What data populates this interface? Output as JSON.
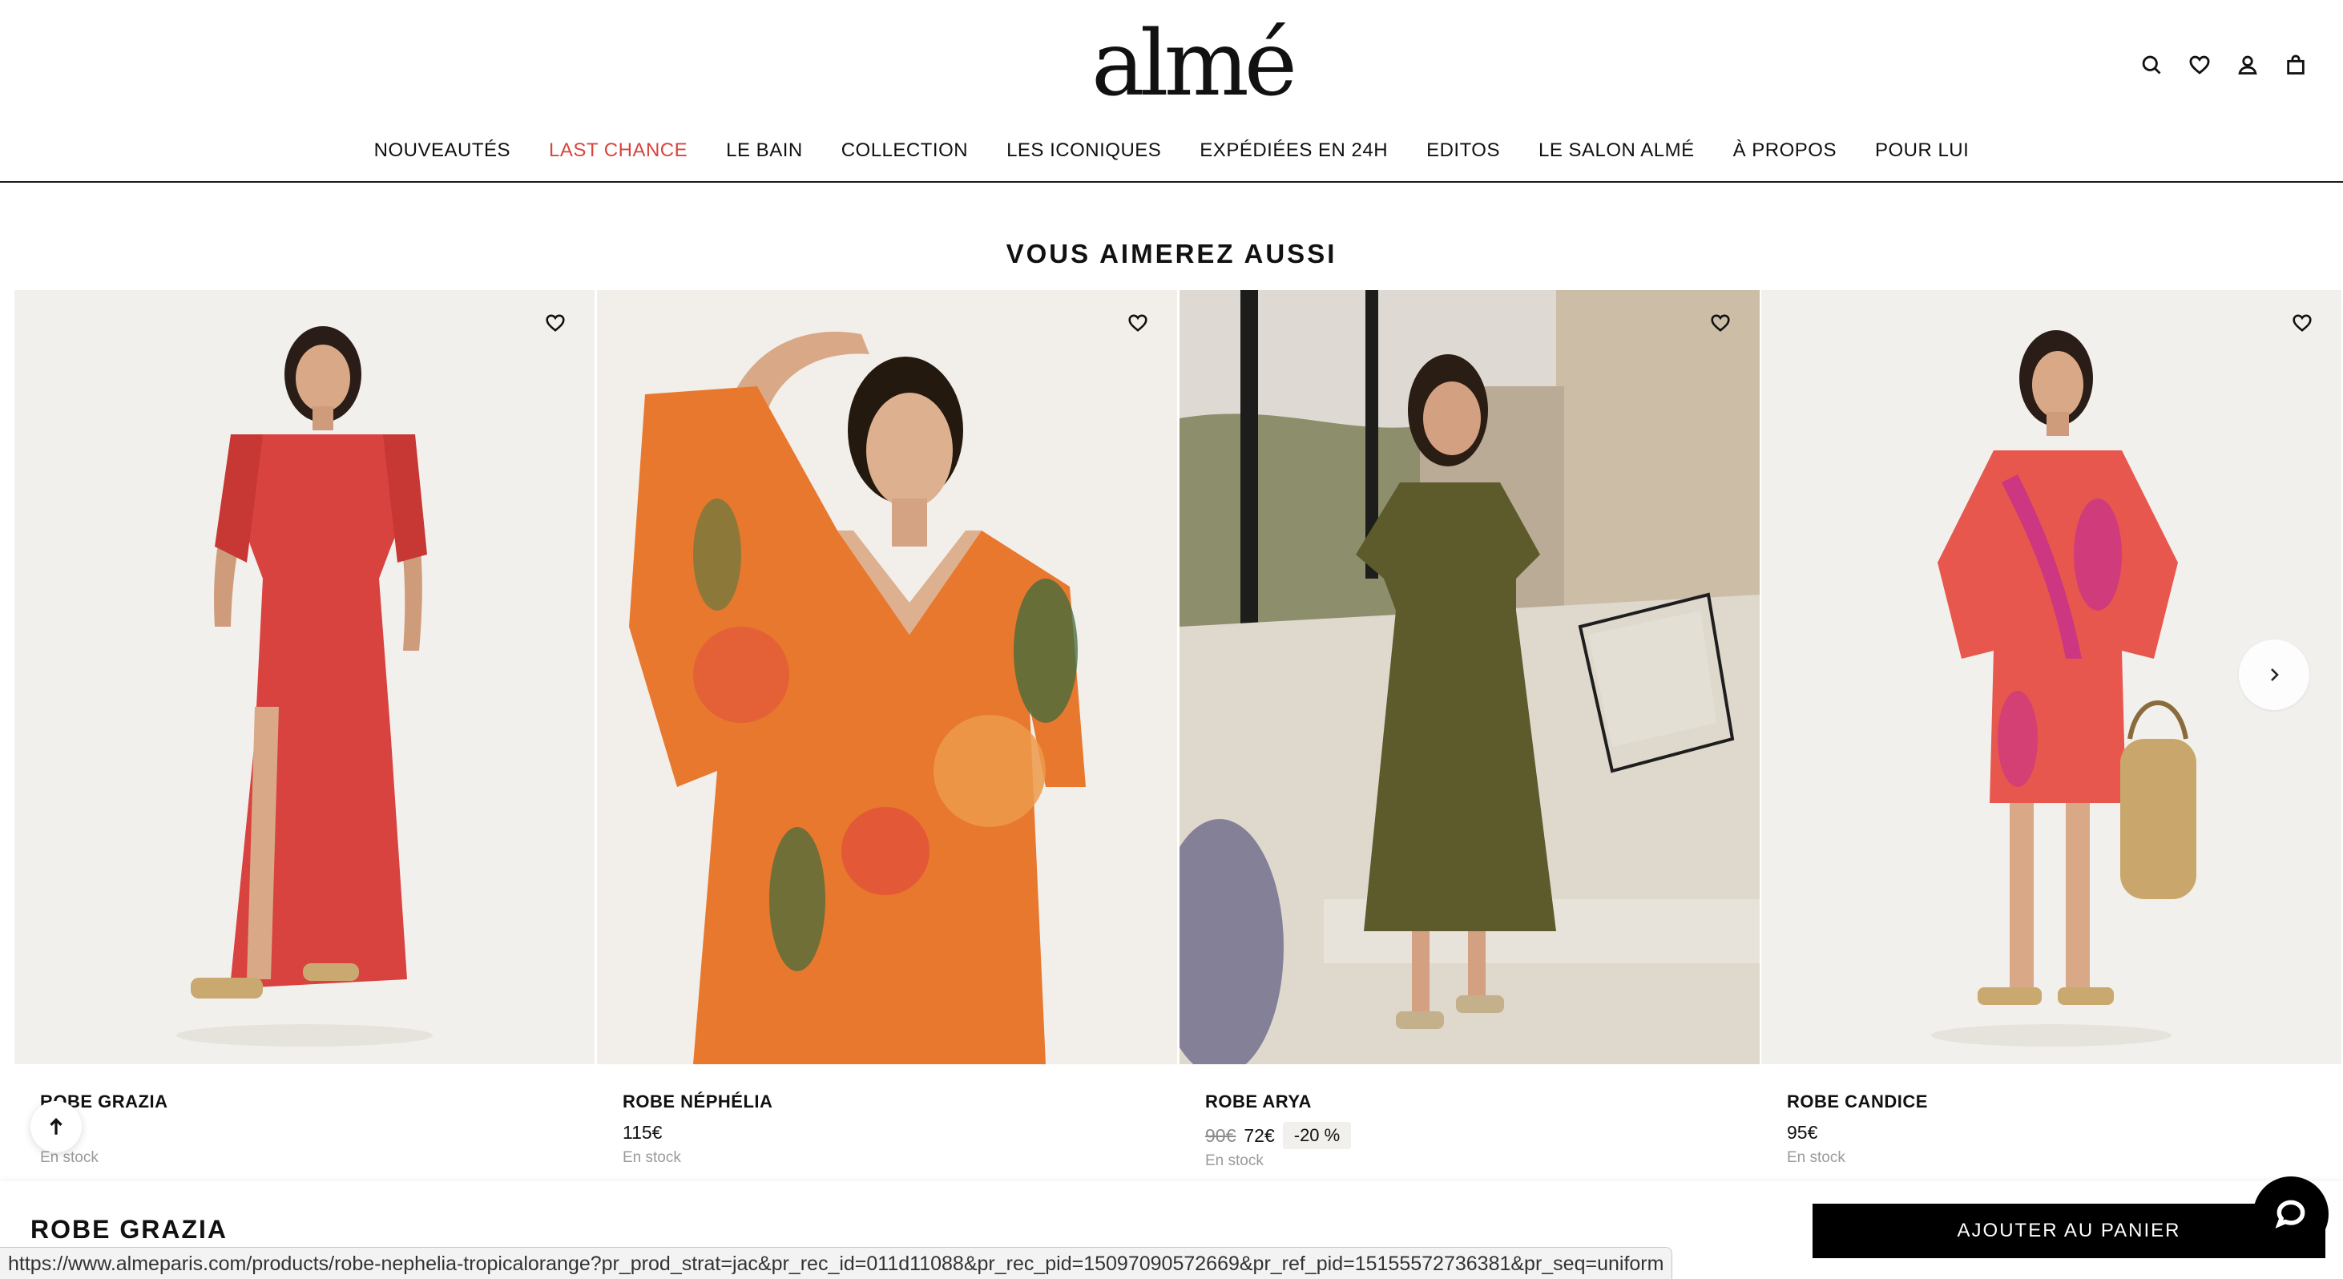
{
  "brand": {
    "logo_text": "almé"
  },
  "header": {
    "icons": [
      "search-icon",
      "heart-icon",
      "user-icon",
      "bag-icon"
    ]
  },
  "nav": {
    "items": [
      {
        "label": "NOUVEAUTÉS"
      },
      {
        "label": "LAST CHANCE",
        "color": "#d8453e"
      },
      {
        "label": "LE BAIN"
      },
      {
        "label": "COLLECTION"
      },
      {
        "label": "LES ICONIQUES"
      },
      {
        "label": "EXPÉDIÉES EN 24H"
      },
      {
        "label": "EDITOS"
      },
      {
        "label": "LE SALON ALMÉ"
      },
      {
        "label": "À PROPOS"
      },
      {
        "label": "POUR LUI"
      }
    ]
  },
  "recommendations": {
    "title": "VOUS AIMEREZ AUSSI",
    "products": [
      {
        "name": "ROBE GRAZIA",
        "price": "",
        "stock": "En stock",
        "dress_color": "#d8423f",
        "bg": "#f2f0ed"
      },
      {
        "name": "ROBE NÉPHÉLIA",
        "price": "115€",
        "stock": "En stock",
        "dress_color": "#e8782e",
        "bg": "#f2efeb"
      },
      {
        "name": "ROBE ARYA",
        "old_price": "90€",
        "price": "72€",
        "discount": "-20 %",
        "stock": "En stock",
        "dress_color": "#5d5a2c",
        "bg": "#cfc5b4"
      },
      {
        "name": "ROBE CANDICE",
        "price": "95€",
        "stock": "En stock",
        "dress_color": "#e8574d",
        "bg": "#f2f0ed"
      }
    ]
  },
  "sticky": {
    "title": "ROBE GRAZIA",
    "add_to_cart": "AJOUTER AU PANIER"
  },
  "status_url": "https://www.almeparis.com/products/robe-nephelia-tropicalorange?pr_prod_strat=jac&pr_rec_id=011d11088&pr_rec_pid=15097090572669&pr_ref_pid=15155572736381&pr_seq=uniform"
}
